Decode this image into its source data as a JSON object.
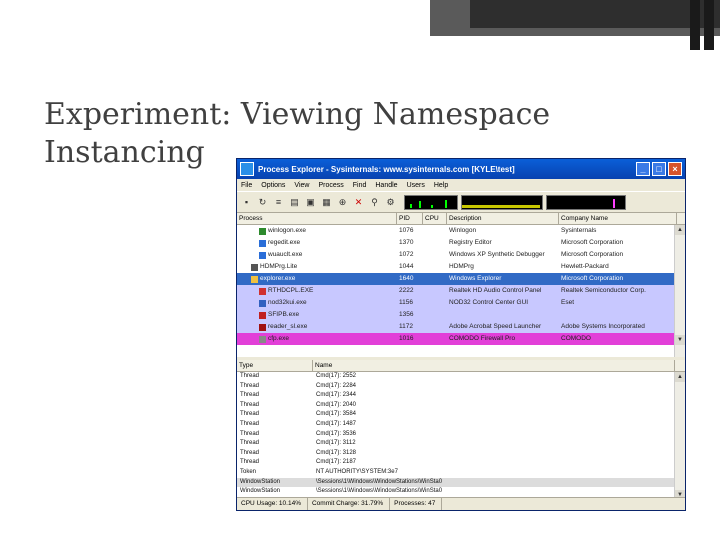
{
  "slide": {
    "title_line1": "Experiment: Viewing Namespace",
    "title_line2": "Instancing"
  },
  "window": {
    "title": "Process Explorer - Sysinternals: www.sysinternals.com [KYLE\\test]",
    "menu": [
      "File",
      "Options",
      "View",
      "Process",
      "Find",
      "Handle",
      "Users",
      "Help"
    ]
  },
  "process_table": {
    "columns": [
      "Process",
      "PID",
      "CPU",
      "Description",
      "Company Name"
    ],
    "rows": [
      {
        "name": "winlogon.exe",
        "pid": "1076",
        "cpu": "",
        "desc": "Winlogon",
        "company": "Sysinternals",
        "color": "#ffffff",
        "icon": "#2d8a2d",
        "indent": 22
      },
      {
        "name": "regedit.exe",
        "pid": "1370",
        "cpu": "",
        "desc": "Registry Editor",
        "company": "Microsoft Corporation",
        "color": "#ffffff",
        "icon": "#2a6ed8",
        "indent": 22
      },
      {
        "name": "wuauclt.exe",
        "pid": "1072",
        "cpu": "",
        "desc": "Windows XP Synthetic Debugger",
        "company": "Microsoft Corporation",
        "color": "#ffffff",
        "icon": "#2a6ed8",
        "indent": 22
      },
      {
        "name": "HDMPrg.Lite",
        "pid": "1044",
        "cpu": "",
        "desc": "HDMPrg",
        "company": "Hewlett-Packard",
        "color": "#ffffff",
        "icon": "#555555",
        "indent": 14
      },
      {
        "name": "explorer.exe",
        "pid": "1640",
        "cpu": "",
        "desc": "Windows Explorer",
        "company": "Microsoft Corporation",
        "color": "#316ac5",
        "icon": "#f0c040",
        "indent": 14,
        "selected": true
      },
      {
        "name": "RTHDCPL.EXE",
        "pid": "2222",
        "cpu": "",
        "desc": "Realtek HD Audio Control Panel",
        "company": "Realtek Semiconductor Corp.",
        "color": "#c8c8ff",
        "icon": "#d03030",
        "indent": 22
      },
      {
        "name": "nod32kui.exe",
        "pid": "1156",
        "cpu": "",
        "desc": "NOD32 Control Center GUI",
        "company": "Eset",
        "color": "#c8c8ff",
        "icon": "#3060c0",
        "indent": 22
      },
      {
        "name": "SFIPB.exe",
        "pid": "1356",
        "cpu": "",
        "desc": "",
        "company": "",
        "color": "#c8c8ff",
        "icon": "#c02020",
        "indent": 22
      },
      {
        "name": "reader_sl.exe",
        "pid": "1172",
        "cpu": "",
        "desc": "Adobe Acrobat Speed Launcher",
        "company": "Adobe Systems Incorporated",
        "color": "#c8c8ff",
        "icon": "#a01010",
        "indent": 22
      },
      {
        "name": "cfp.exe",
        "pid": "1016",
        "cpu": "",
        "desc": "COMODO Firewall Pro",
        "company": "COMODO",
        "color": "#e23fd8",
        "icon": "#888888",
        "indent": 22
      }
    ]
  },
  "handle_table": {
    "columns": [
      "Type",
      "Name"
    ],
    "rows": [
      {
        "type": "Thread",
        "name": "Cmd(17): 2552"
      },
      {
        "type": "Thread",
        "name": "Cmd(17): 2284"
      },
      {
        "type": "Thread",
        "name": "Cmd(17): 2344"
      },
      {
        "type": "Thread",
        "name": "Cmd(17): 2040"
      },
      {
        "type": "Thread",
        "name": "Cmd(17): 3584"
      },
      {
        "type": "Thread",
        "name": "Cmd(17): 1487"
      },
      {
        "type": "Thread",
        "name": "Cmd(17): 3536"
      },
      {
        "type": "Thread",
        "name": "Cmd(17): 3112"
      },
      {
        "type": "Thread",
        "name": "Cmd(17): 3128"
      },
      {
        "type": "Thread",
        "name": "Cmd(17): 2187"
      },
      {
        "type": "Token",
        "name": "NT AUTHORITY\\SYSTEM:3e7"
      },
      {
        "type": "WindowStation",
        "name": "\\Sessions\\1\\Windows\\WindowStations\\WinSta0",
        "highlight": true
      },
      {
        "type": "WindowStation",
        "name": "\\Sessions\\1\\Windows\\WindowStations\\WinSta0"
      }
    ]
  },
  "status": {
    "cpu": "CPU Usage: 10.14%",
    "commit": "Commit Charge: 31.79%",
    "processes": "Processes: 47"
  }
}
